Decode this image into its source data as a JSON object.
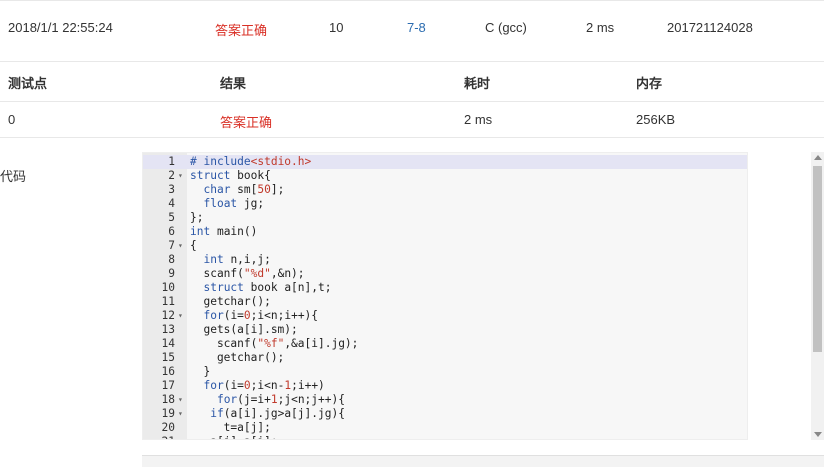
{
  "submission": {
    "time": "2018/1/1 22:55:24",
    "status": "答案正确",
    "score": "10",
    "problem": "7-8",
    "compiler": "C (gcc)",
    "duration": "2 ms",
    "user": "201721124028"
  },
  "testcases": {
    "headers": [
      "测试点",
      "结果",
      "耗时",
      "内存"
    ],
    "rows": [
      {
        "id": "0",
        "result": "答案正确",
        "time": "2 ms",
        "memory": "256KB"
      }
    ]
  },
  "code_label": "代码",
  "code_lines": [
    "# include<stdio.h>",
    "struct book{",
    "  char sm[50];",
    "  float jg;",
    "};",
    "int main()",
    "{",
    "  int n,i,j;",
    "  scanf(\"%d\",&n);",
    "  struct book a[n],t;",
    "  getchar();",
    "  for(i=0;i<n;i++){",
    "  gets(a[i].sm);",
    "    scanf(\"%f\",&a[i].jg);",
    "    getchar();",
    "  }",
    "  for(i=0;i<n-1;i++)",
    "    for(j=i+1;j<n;j++){",
    "   if(a[i].jg>a[j].jg){",
    "     t=a[j];",
    "   a[j]=a[i];"
  ],
  "fold_lines": [
    2,
    7,
    12,
    18,
    19
  ],
  "colors": {
    "accent": "#d93026",
    "link": "#2b6cb0"
  }
}
